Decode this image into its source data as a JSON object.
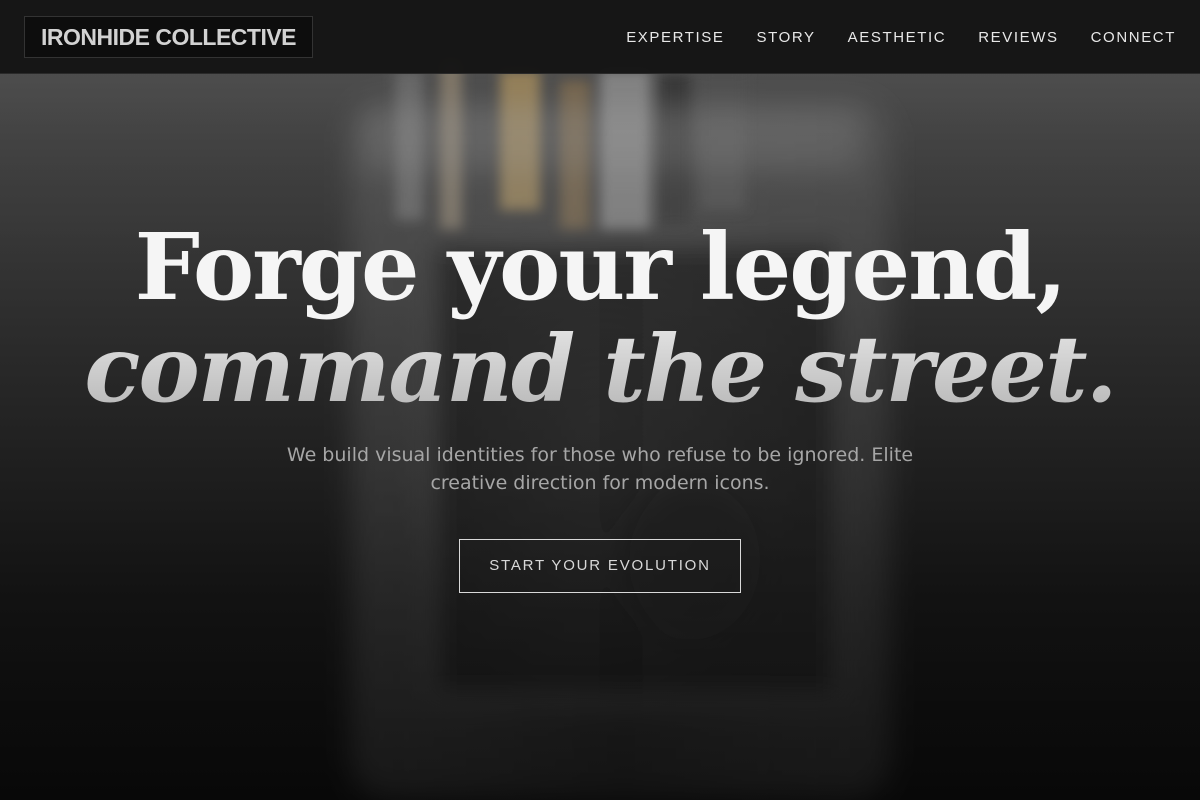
{
  "brand": {
    "name": "IRONHIDE COLLECTIVE"
  },
  "nav": {
    "items": [
      "EXPERTISE",
      "STORY",
      "AESTHETIC",
      "REVIEWS",
      "CONNECT"
    ]
  },
  "hero": {
    "headline_line1": "Forge your legend,",
    "headline_line2": "command the street.",
    "subhead": "We build visual identities for those who refuse to be ignored. Elite creative direction for modern icons.",
    "cta_label": "START YOUR EVOLUTION"
  },
  "colors": {
    "header_bg": "#141414",
    "text_primary": "#f5f5f5",
    "text_muted": "#a6a6a6",
    "accent_border": "#d9d9d9"
  }
}
